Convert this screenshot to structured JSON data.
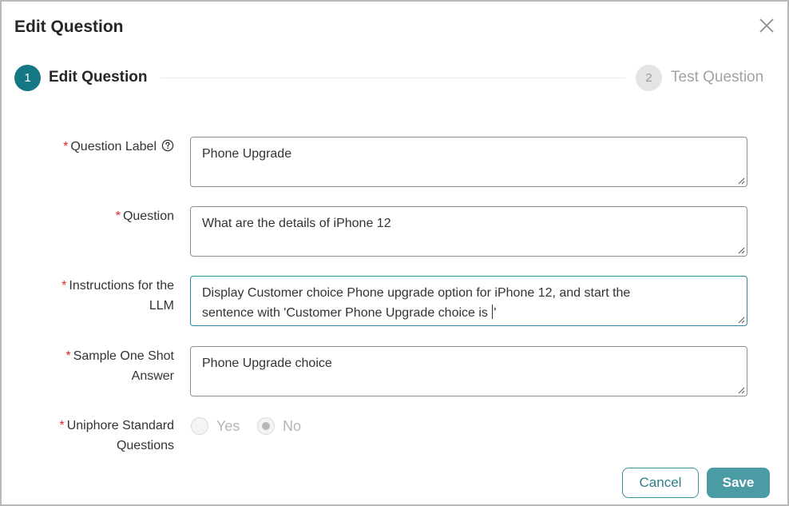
{
  "dialog": {
    "title": "Edit Question"
  },
  "stepper": {
    "steps": [
      {
        "number": "1",
        "label": "Edit Question",
        "state": "active"
      },
      {
        "number": "2",
        "label": "Test Question",
        "state": "inactive"
      }
    ]
  },
  "form": {
    "question_label": {
      "label": "Question Label",
      "value": "Phone Upgrade"
    },
    "question": {
      "label": "Question",
      "value": "What are the details of iPhone 12"
    },
    "instructions": {
      "label_line1": "Instructions for the",
      "label_line2": "LLM",
      "value_line1": "Display Customer choice Phone upgrade option for iPhone 12, and start the",
      "value_line2_before_caret": "sentence with 'Customer Phone Upgrade choice is ",
      "value_line2_after_caret": "'"
    },
    "sample_answer": {
      "label_line1": "Sample One Shot",
      "label_line2": "Answer",
      "value": "Phone Upgrade choice"
    },
    "standard_questions": {
      "label_line1": "Uniphore Standard",
      "label_line2": "Questions",
      "options": [
        {
          "label": "Yes",
          "selected": false
        },
        {
          "label": "No",
          "selected": true
        }
      ]
    },
    "required_marker": "*"
  },
  "actions": {
    "cancel_label": "Cancel",
    "save_label": "Save"
  },
  "colors": {
    "accent": "#147784",
    "save_button": "#4a9ba3",
    "required": "#e02424"
  }
}
